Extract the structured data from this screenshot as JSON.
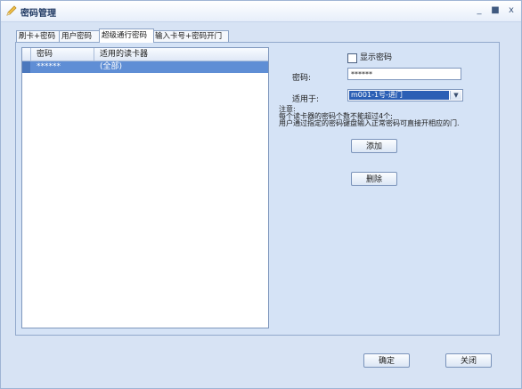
{
  "window": {
    "title": "密码管理"
  },
  "tabs": [
    {
      "label": "刷卡+密码"
    },
    {
      "label": "用户密码"
    },
    {
      "label": "超级通行密码"
    },
    {
      "label": "输入卡号+密码开门"
    }
  ],
  "grid": {
    "columns": [
      "密码",
      "适用的读卡器"
    ],
    "rows": [
      {
        "password": "******",
        "reader": "(全部)"
      }
    ]
  },
  "form": {
    "show_password_label": "显示密码",
    "password_label": "密码:",
    "password_value": "******",
    "apply_to_label": "适用于:",
    "apply_to_value": "m001-1号-进门",
    "notes": [
      "注意:",
      "每个读卡器的密码个数不能超过4个;",
      "用户通过指定的密码键盘输入正常密码可直接开相应的门."
    ],
    "add_label": "添加",
    "delete_label": "删除"
  },
  "footer": {
    "ok_label": "确定",
    "close_label": "关闭"
  }
}
